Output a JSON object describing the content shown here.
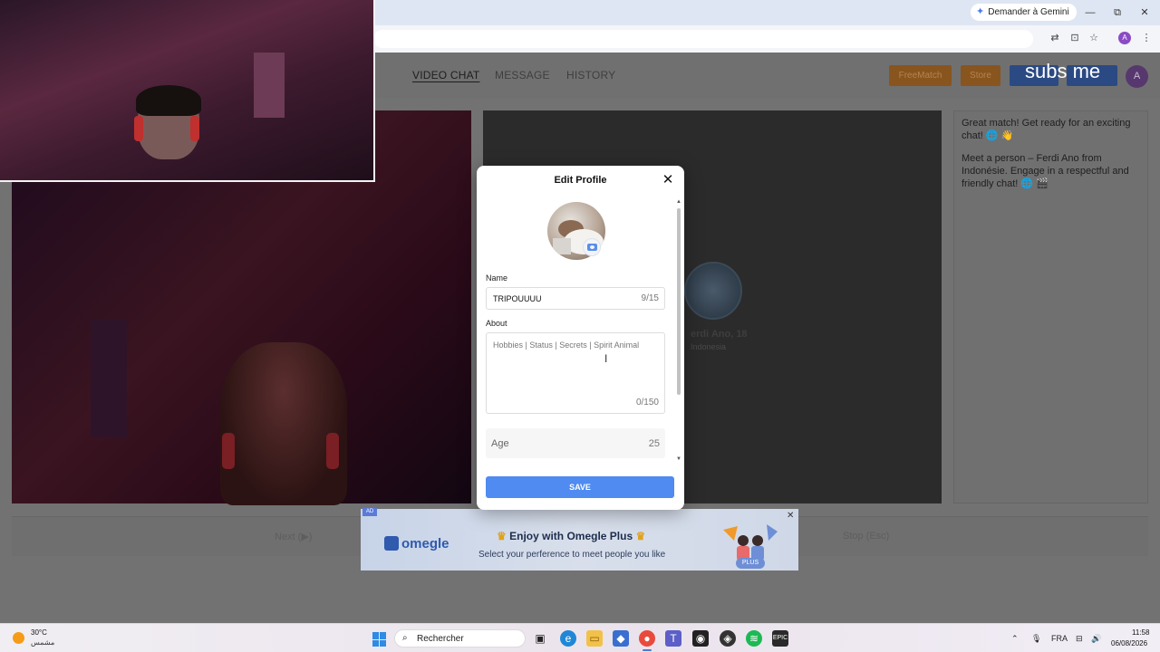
{
  "browser": {
    "gemini_label": "Demander à Gemini",
    "window_controls": {
      "minimize": "—",
      "restore": "⧉",
      "close": "✕"
    }
  },
  "nav": {
    "tabs": [
      "VIDEO CHAT",
      "MESSAGE",
      "HISTORY"
    ],
    "active_tab": "VIDEO CHAT",
    "freematch_label": "FreeMatch",
    "store_label": "Store",
    "user_initial": "A"
  },
  "overlay_text": "subs me",
  "partner": {
    "name": "erdi Ano, 18",
    "country": "Indonesia"
  },
  "chat": {
    "messages": [
      "Great match! Get ready for an exciting chat! 🌐 👋",
      "Meet a person – Ferdi Ano from Indonésie. Engage in a respectful and friendly chat! 🌐 🎬"
    ]
  },
  "controls": {
    "next_label": "Next (▶)",
    "stop_label": "Stop (Esc)"
  },
  "modal": {
    "title": "Edit Profile",
    "name_label": "Name",
    "name_value": "TRIPOUUUU",
    "name_count": "9/15",
    "about_label": "About",
    "about_placeholder": "Hobbies | Status | Secrets | Spirit Animal",
    "about_count": "0/150",
    "age_label": "Age",
    "age_value": "25",
    "save_label": "SAVE"
  },
  "ad": {
    "tag": "AD",
    "logo_text": "omegle",
    "title": "Enjoy with Omegle Plus",
    "subtitle": "Select your perference to meet people you like",
    "plus_badge": "PLUS"
  },
  "taskbar": {
    "weather_temp": "30°C",
    "weather_desc": "مشمس",
    "search_placeholder": "Rechercher",
    "language": "FRA",
    "time": "11:58",
    "date": "06/08/2026"
  },
  "colors": {
    "save_button": "#4f8bf0",
    "freematch_button": "#88551e",
    "accent_blue": "#2f8be5"
  }
}
